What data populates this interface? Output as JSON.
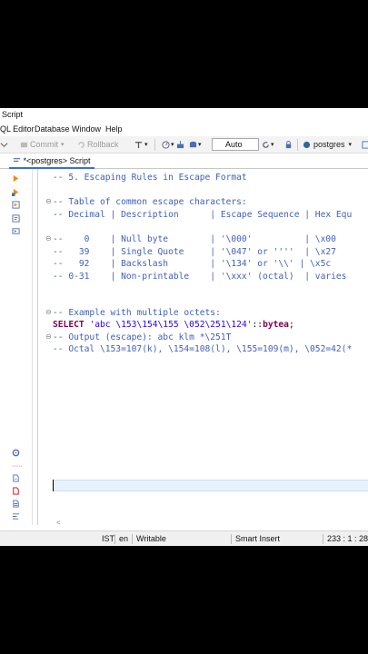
{
  "window": {
    "title": "Script"
  },
  "menu": [
    "QL Editor",
    "Database",
    "Window",
    "Help"
  ],
  "toolbar": {
    "commit": "Commit",
    "rollback": "Rollback",
    "mode": "Auto",
    "datasource": "postgres"
  },
  "tab": {
    "label": "*<postgres> Script"
  },
  "editor": {
    "lines": [
      "-- 5. Escaping Rules in Escape Format",
      "-- Table of common escape characters:",
      "-- Decimal | Description      | Escape Sequence | Hex Equ",
      "--    0    | Null byte        | '\\000'          | \\x00",
      "--   39    | Single Quote     | '\\047' or ''''  | \\x27",
      "--   92    | Backslash        | '\\134' or '\\\\' | \\x5c",
      "-- 0-31    | Non-printable    | '\\xxx' (octal)  | varies",
      "-- Example with multiple octets:",
      "SELECT 'abc \\153\\154\\155 \\052\\251\\124'::bytea;",
      "-- Output (escape): abc klm *\\251T",
      "-- Octal \\153=107(k), \\154=108(l), \\155=109(m), \\052=42(*"
    ],
    "select_kw": "SELECT",
    "select_str": "'abc \\153\\154\\155 \\052\\251\\124'",
    "select_tail": "::",
    "select_type": "bytea",
    "select_end": ";"
  },
  "status": {
    "timezone": "IST",
    "locale": "en",
    "mode": "Writable",
    "insert": "Smart Insert",
    "position": "233 : 1 : 28"
  },
  "colors": {
    "comment": "#3f5fbf",
    "keyword": "#7f0055",
    "string": "#2a00ff",
    "accent": "#3b6fd4"
  }
}
